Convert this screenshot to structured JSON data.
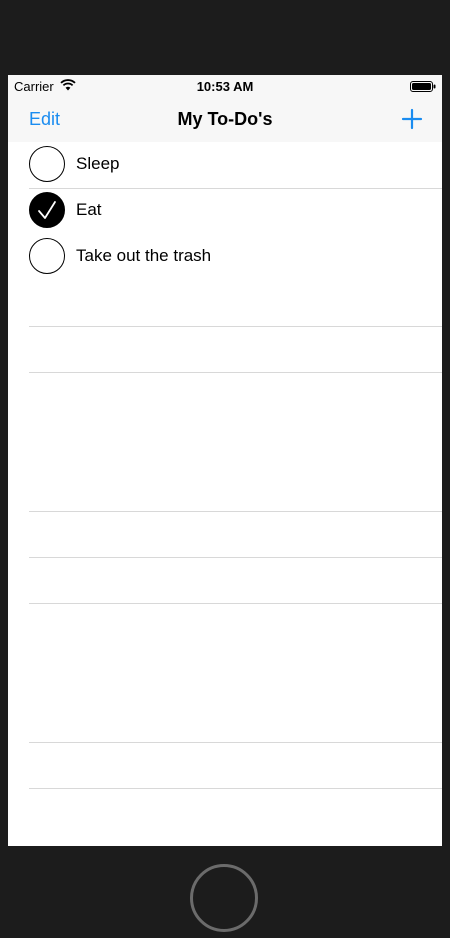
{
  "status_bar": {
    "carrier": "Carrier",
    "time": "10:53 AM",
    "wifi_icon": "wifi-icon",
    "battery_icon": "battery-icon"
  },
  "nav_bar": {
    "edit_label": "Edit",
    "title": "My To-Do's",
    "add_icon": "plus-icon"
  },
  "todos": [
    {
      "label": "Sleep",
      "done": false
    },
    {
      "label": "Eat",
      "done": true
    },
    {
      "label": "Take out the trash",
      "done": false
    }
  ],
  "colors": {
    "accent": "#1a8cf0",
    "bar_background": "#f7f7f7",
    "device_frame": "#1c1c1c"
  }
}
